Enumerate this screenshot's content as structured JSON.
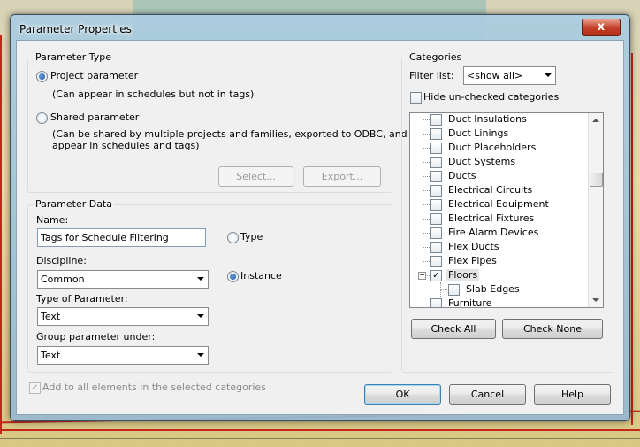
{
  "window": {
    "title": "Parameter Properties",
    "close_glyph": "x"
  },
  "parameter_type": {
    "group_label": "Parameter Type",
    "project_label": "Project parameter",
    "project_note": "(Can appear in schedules but not in tags)",
    "shared_label": "Shared parameter",
    "shared_note_line1": "(Can be shared by multiple projects and families, exported to ODBC, and",
    "shared_note_line2": "appear in schedules and tags)",
    "selected": "project",
    "select_button": "Select...",
    "export_button": "Export..."
  },
  "parameter_data": {
    "group_label": "Parameter Data",
    "name_label": "Name:",
    "name_value": "Tags for Schedule Filtering",
    "discipline_label": "Discipline:",
    "discipline_value": "Common",
    "type_of_parameter_label": "Type of Parameter:",
    "type_of_parameter_value": "Text",
    "group_under_label": "Group parameter under:",
    "group_under_value": "Text",
    "type_radio": "Type",
    "instance_radio": "Instance",
    "instance_selected": true
  },
  "add_to_all": {
    "label": "Add to all elements in the selected categories",
    "checked": true,
    "disabled": true
  },
  "categories": {
    "group_label": "Categories",
    "filter_label": "Filter list:",
    "filter_value": "<show all>",
    "hide_unchecked_label": "Hide un-checked categories",
    "items": [
      {
        "label": "Duct Insulations",
        "checked": false
      },
      {
        "label": "Duct Linings",
        "checked": false
      },
      {
        "label": "Duct Placeholders",
        "checked": false
      },
      {
        "label": "Duct Systems",
        "checked": false
      },
      {
        "label": "Ducts",
        "checked": false
      },
      {
        "label": "Electrical Circuits",
        "checked": false
      },
      {
        "label": "Electrical Equipment",
        "checked": false
      },
      {
        "label": "Electrical Fixtures",
        "checked": false
      },
      {
        "label": "Fire Alarm Devices",
        "checked": false
      },
      {
        "label": "Flex Ducts",
        "checked": false
      },
      {
        "label": "Flex Pipes",
        "checked": false
      },
      {
        "label": "Floors",
        "checked": true
      },
      {
        "label": "Slab Edges",
        "checked": false
      },
      {
        "label": "Furniture",
        "checked": false
      }
    ],
    "check_all_button": "Check All",
    "check_none_button": "Check None"
  },
  "footer": {
    "ok_button": "OK",
    "cancel_button": "Cancel",
    "help_button": "Help"
  },
  "colors": {
    "default_button_border": "#3c7fb1",
    "selection": "#e5e5e5"
  }
}
